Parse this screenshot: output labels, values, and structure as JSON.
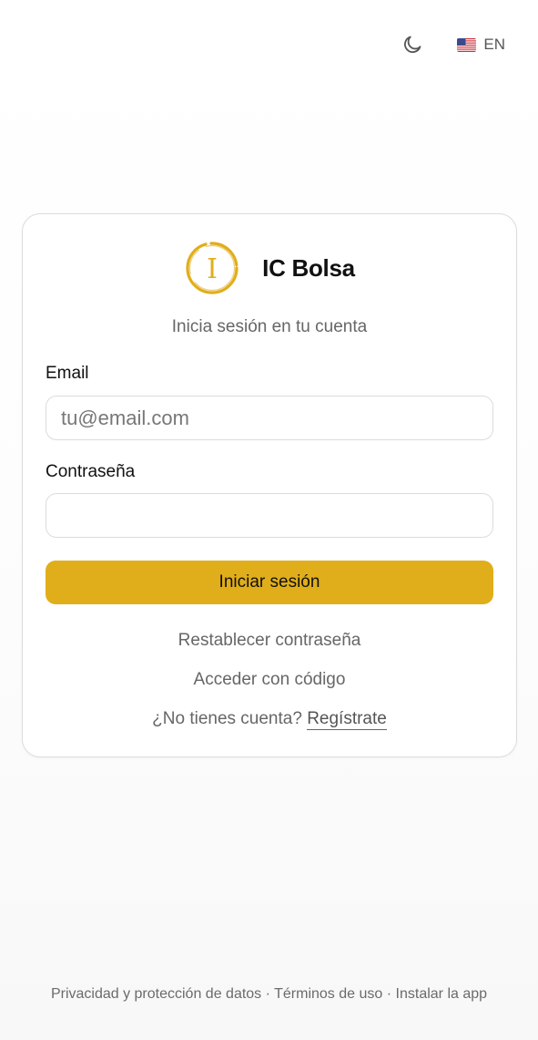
{
  "topbar": {
    "theme_icon": "moon-icon",
    "language_flag": "us-flag-icon",
    "language_label": "EN"
  },
  "brand": {
    "logo_icon": "ic-bolsa-logo",
    "logo_letter": "I",
    "name": "IC Bolsa",
    "accent_color": "#e0ae1a"
  },
  "login": {
    "subtitle": "Inicia sesión en tu cuenta",
    "email_label": "Email",
    "email_placeholder": "tu@email.com",
    "email_value": "",
    "password_label": "Contraseña",
    "password_value": "",
    "submit_label": "Iniciar sesión",
    "reset_password_link": "Restablecer contraseña",
    "code_access_link": "Acceder con código",
    "no_account_text": "¿No tienes cuenta?",
    "register_link": "Regístrate"
  },
  "footer": {
    "privacy_link": "Privacidad y protección de datos",
    "separator": "·",
    "terms_link": "Términos de uso",
    "install_link": "Instalar la app"
  }
}
